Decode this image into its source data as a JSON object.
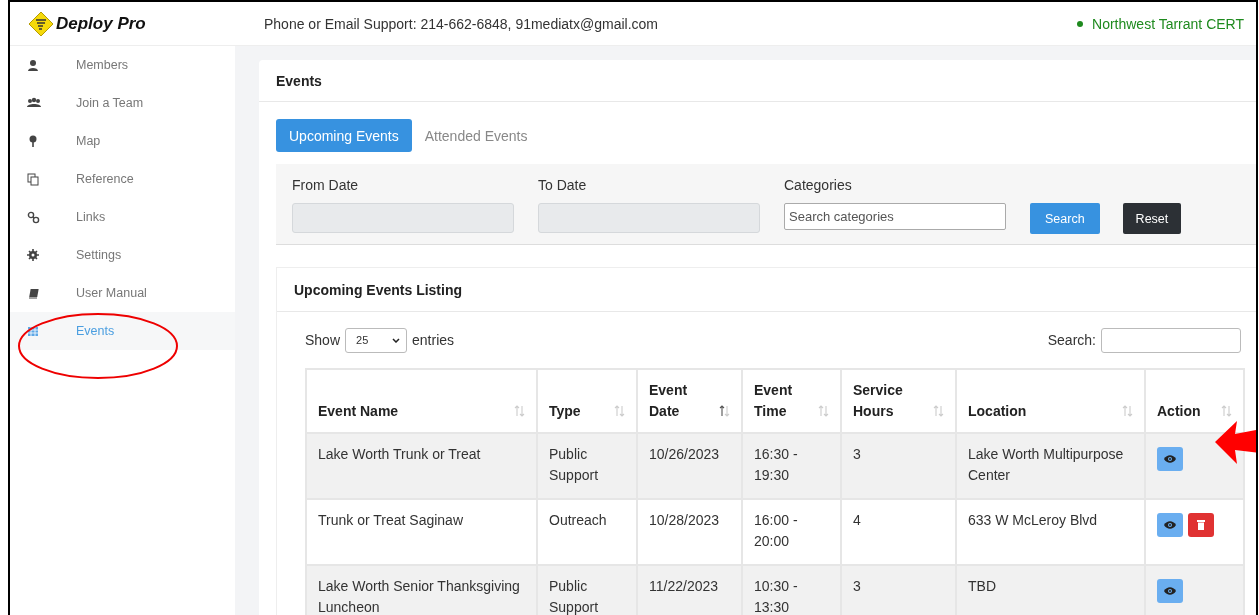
{
  "header": {
    "logo": "Deploy Pro",
    "support": "Phone or Email Support: 214-662-6848, 91mediatx@gmail.com",
    "organization": "Northwest Tarrant CERT"
  },
  "sidebar": {
    "items": [
      {
        "label": "Members",
        "kind": "user",
        "selected": false
      },
      {
        "label": "Join a Team",
        "kind": "team",
        "selected": false
      },
      {
        "label": "Map",
        "kind": "pin",
        "selected": false
      },
      {
        "label": "Reference",
        "kind": "copy",
        "selected": false
      },
      {
        "label": "Links",
        "kind": "link",
        "selected": false
      },
      {
        "label": "Settings",
        "kind": "gear",
        "selected": false
      },
      {
        "label": "User Manual",
        "kind": "book",
        "selected": false
      },
      {
        "label": "Events",
        "kind": "calendar",
        "selected": true
      }
    ]
  },
  "events_card": {
    "title": "Events",
    "tabs": [
      {
        "label": "Upcoming Events",
        "selected": true
      },
      {
        "label": "Attended Events",
        "selected": false
      }
    ],
    "filters": {
      "from_label": "From Date",
      "to_label": "To Date",
      "categories_label": "Categories",
      "categories_placeholder": "Search categories",
      "search_button": "Search",
      "reset_button": "Reset"
    }
  },
  "listing": {
    "title": "Upcoming Events Listing",
    "show_label": "Show",
    "page_size": "25",
    "entries_label": "entries",
    "search_label": "Search:",
    "columns": [
      {
        "lines": [
          "Event Name"
        ],
        "sorted": false
      },
      {
        "lines": [
          "Type"
        ],
        "sorted": false
      },
      {
        "lines": [
          "Event",
          "Date"
        ],
        "sorted": true
      },
      {
        "lines": [
          "Event",
          "Time"
        ],
        "sorted": false
      },
      {
        "lines": [
          "Service",
          "Hours"
        ],
        "sorted": false
      },
      {
        "lines": [
          "Location"
        ],
        "sorted": false
      },
      {
        "lines": [
          "Action"
        ],
        "sorted": false
      }
    ],
    "rows": [
      {
        "cells": [
          "Lake Worth Trunk or Treat",
          "Public Support",
          "10/26/2023",
          "16:30 - 19:30",
          "3",
          "Lake Worth Multipurpose Center"
        ],
        "actions": [
          {
            "kind": "view"
          }
        ]
      },
      {
        "cells": [
          "Trunk or Treat Saginaw",
          "Outreach",
          "10/28/2023",
          "16:00 - 20:00",
          "4",
          "633 W McLeroy Blvd"
        ],
        "actions": [
          {
            "kind": "view"
          },
          {
            "kind": "delete"
          }
        ]
      },
      {
        "cells": [
          "Lake Worth Senior Thanksgiving Luncheon",
          "Public Support",
          "11/22/2023",
          "10:30 - 13:30",
          "3",
          "TBD"
        ],
        "actions": [
          {
            "kind": "view"
          }
        ]
      }
    ]
  },
  "annotations": {
    "ellipse": true,
    "arrow": true
  }
}
